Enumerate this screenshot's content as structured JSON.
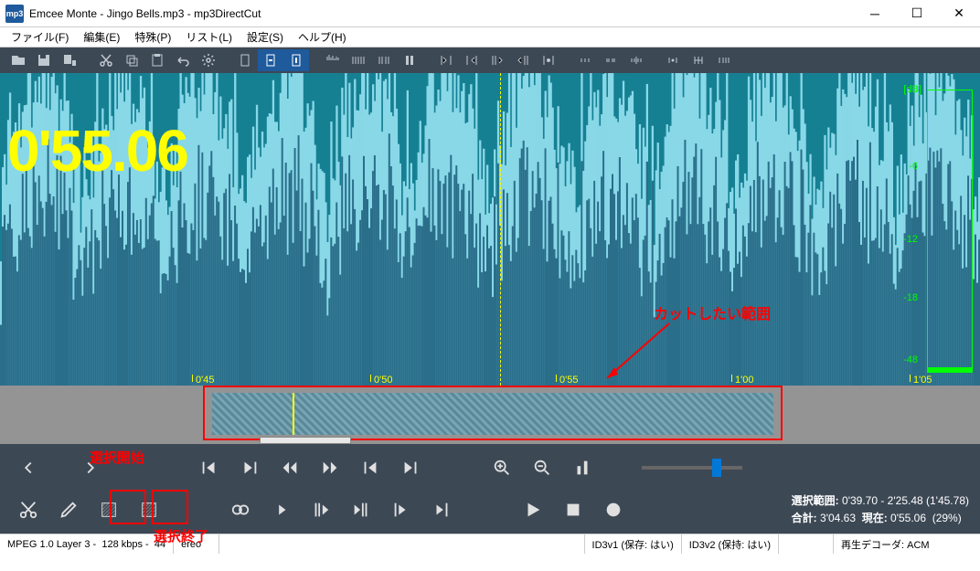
{
  "window": {
    "app_icon_text": "mp3",
    "title": "Emcee Monte - Jingo Bells.mp3 - mp3DirectCut"
  },
  "menus": [
    "ファイル(F)",
    "編集(E)",
    "特殊(P)",
    "リスト(L)",
    "設定(S)",
    "ヘルプ(H)"
  ],
  "big_time": "0'55.06",
  "db_unit": "[dB]",
  "db_ticks": [
    "0",
    "-6",
    "-12",
    "-18",
    "-48"
  ],
  "ruler_ticks": [
    {
      "pos": 210,
      "label": "0'45"
    },
    {
      "pos": 405,
      "label": "0'50"
    },
    {
      "pos": 608,
      "label": "0'55"
    },
    {
      "pos": 800,
      "label": "1'00"
    },
    {
      "pos": 995,
      "label": "1'05"
    }
  ],
  "annotation_cut": "カットしたい範囲",
  "label_sel_start": "選択開始",
  "label_sel_end": "選択終了",
  "info_line1_label": "選択範囲:",
  "info_line1_value": "0'39.70 - 2'25.48 (1'45.78)",
  "info_line2_a_label": "合計:",
  "info_line2_a_value": "3'04.63",
  "info_line2_b_label": "現在:",
  "info_line2_b_value": "0'55.06",
  "info_line2_pct": "(29%)",
  "status": {
    "format": "MPEG 1.0 Layer 3",
    "bitrate": "128 kbps",
    "khz": "44",
    "stereo": "ereo",
    "id3v1": "ID3v1 (保存: はい)",
    "id3v2": "ID3v2 (保持: はい)",
    "decoder": "再生デコーダ: ACM"
  }
}
